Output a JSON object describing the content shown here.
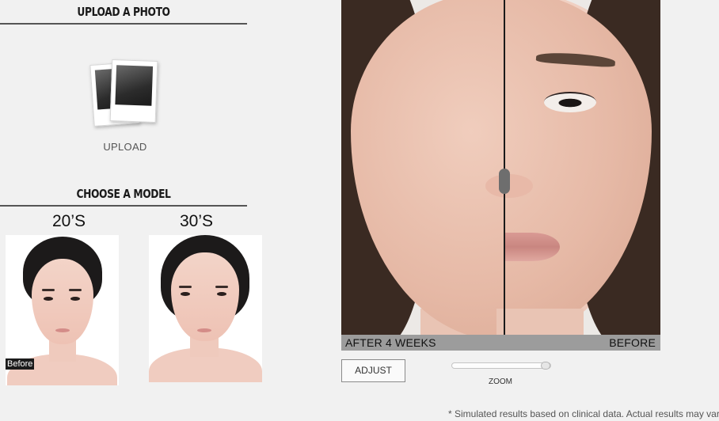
{
  "upload_section": {
    "title": "UPLOAD A PHOTO",
    "upload_label": "UPLOAD",
    "icon": "photos-icon"
  },
  "model_section": {
    "title": "CHOOSE A MODEL",
    "models": [
      {
        "label": "20’S",
        "badge": "Before"
      },
      {
        "label": "30’S"
      }
    ]
  },
  "viewer": {
    "after_label": "AFTER 4 WEEKS",
    "before_label": "BEFORE",
    "split_position_fraction": 0.51
  },
  "controls": {
    "adjust_label": "ADJUST",
    "zoom_label": "ZOOM",
    "zoom_level_fraction": 0.95
  },
  "disclaimer": "* Simulated results based on clinical data. Actual results may vary."
}
